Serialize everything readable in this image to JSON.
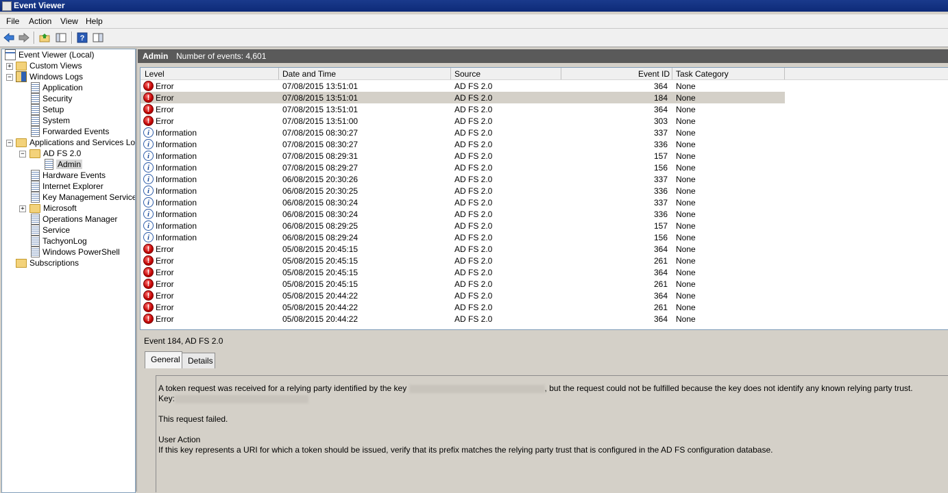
{
  "window": {
    "title": "Event Viewer"
  },
  "menubar": [
    "File",
    "Action",
    "View",
    "Help"
  ],
  "toolbar": {
    "icons": [
      "back-arrow-icon",
      "forward-arrow-icon",
      "up-folder-icon",
      "show-hide-tree-icon",
      "help-icon",
      "properties-icon"
    ]
  },
  "tree": {
    "root": "Event Viewer (Local)",
    "custom_views": "Custom Views",
    "windows_logs": "Windows Logs",
    "windows_log_items": [
      "Application",
      "Security",
      "Setup",
      "System",
      "Forwarded Events"
    ],
    "apps_services": "Applications and Services Logs",
    "adfs": "AD FS 2.0",
    "admin": "Admin",
    "app_items": [
      "Hardware Events",
      "Internet Explorer",
      "Key Management Service"
    ],
    "microsoft": "Microsoft",
    "app_items2": [
      "Operations Manager",
      "Service",
      "TachyonLog",
      "Windows PowerShell"
    ],
    "subscriptions": "Subscriptions"
  },
  "header": {
    "title": "Admin",
    "count_label": "Number of events: 4,601"
  },
  "columns": {
    "level": "Level",
    "datetime": "Date and Time",
    "source": "Source",
    "event_id": "Event ID",
    "task": "Task Category"
  },
  "events": [
    {
      "level": "Error",
      "datetime": "07/08/2015 13:51:01",
      "source": "AD FS 2.0",
      "id": "364",
      "task": "None"
    },
    {
      "level": "Error",
      "datetime": "07/08/2015 13:51:01",
      "source": "AD FS 2.0",
      "id": "184",
      "task": "None"
    },
    {
      "level": "Error",
      "datetime": "07/08/2015 13:51:01",
      "source": "AD FS 2.0",
      "id": "364",
      "task": "None"
    },
    {
      "level": "Error",
      "datetime": "07/08/2015 13:51:00",
      "source": "AD FS 2.0",
      "id": "303",
      "task": "None"
    },
    {
      "level": "Information",
      "datetime": "07/08/2015 08:30:27",
      "source": "AD FS 2.0",
      "id": "337",
      "task": "None"
    },
    {
      "level": "Information",
      "datetime": "07/08/2015 08:30:27",
      "source": "AD FS 2.0",
      "id": "336",
      "task": "None"
    },
    {
      "level": "Information",
      "datetime": "07/08/2015 08:29:31",
      "source": "AD FS 2.0",
      "id": "157",
      "task": "None"
    },
    {
      "level": "Information",
      "datetime": "07/08/2015 08:29:27",
      "source": "AD FS 2.0",
      "id": "156",
      "task": "None"
    },
    {
      "level": "Information",
      "datetime": "06/08/2015 20:30:26",
      "source": "AD FS 2.0",
      "id": "337",
      "task": "None"
    },
    {
      "level": "Information",
      "datetime": "06/08/2015 20:30:25",
      "source": "AD FS 2.0",
      "id": "336",
      "task": "None"
    },
    {
      "level": "Information",
      "datetime": "06/08/2015 08:30:24",
      "source": "AD FS 2.0",
      "id": "337",
      "task": "None"
    },
    {
      "level": "Information",
      "datetime": "06/08/2015 08:30:24",
      "source": "AD FS 2.0",
      "id": "336",
      "task": "None"
    },
    {
      "level": "Information",
      "datetime": "06/08/2015 08:29:25",
      "source": "AD FS 2.0",
      "id": "157",
      "task": "None"
    },
    {
      "level": "Information",
      "datetime": "06/08/2015 08:29:24",
      "source": "AD FS 2.0",
      "id": "156",
      "task": "None"
    },
    {
      "level": "Error",
      "datetime": "05/08/2015 20:45:15",
      "source": "AD FS 2.0",
      "id": "364",
      "task": "None"
    },
    {
      "level": "Error",
      "datetime": "05/08/2015 20:45:15",
      "source": "AD FS 2.0",
      "id": "261",
      "task": "None"
    },
    {
      "level": "Error",
      "datetime": "05/08/2015 20:45:15",
      "source": "AD FS 2.0",
      "id": "364",
      "task": "None"
    },
    {
      "level": "Error",
      "datetime": "05/08/2015 20:45:15",
      "source": "AD FS 2.0",
      "id": "261",
      "task": "None"
    },
    {
      "level": "Error",
      "datetime": "05/08/2015 20:44:22",
      "source": "AD FS 2.0",
      "id": "364",
      "task": "None"
    },
    {
      "level": "Error",
      "datetime": "05/08/2015 20:44:22",
      "source": "AD FS 2.0",
      "id": "261",
      "task": "None"
    },
    {
      "level": "Error",
      "datetime": "05/08/2015 20:44:22",
      "source": "AD FS 2.0",
      "id": "364",
      "task": "None"
    }
  ],
  "selected_index": 1,
  "detail": {
    "title": "Event 184, AD FS 2.0",
    "tabs": [
      "General",
      "Details"
    ],
    "line1_a": "A token request was received for a relying party identified by the key",
    "line1_b": ", but the request could not be fulfilled because the key does not identify any known relying party trust.",
    "key_label": "Key:",
    "line3": "This request failed.",
    "line4": "User Action",
    "line5": "If this key represents a URI for which a token should be issued, verify that its prefix matches the relying party trust that is configured in the AD FS configuration database."
  }
}
